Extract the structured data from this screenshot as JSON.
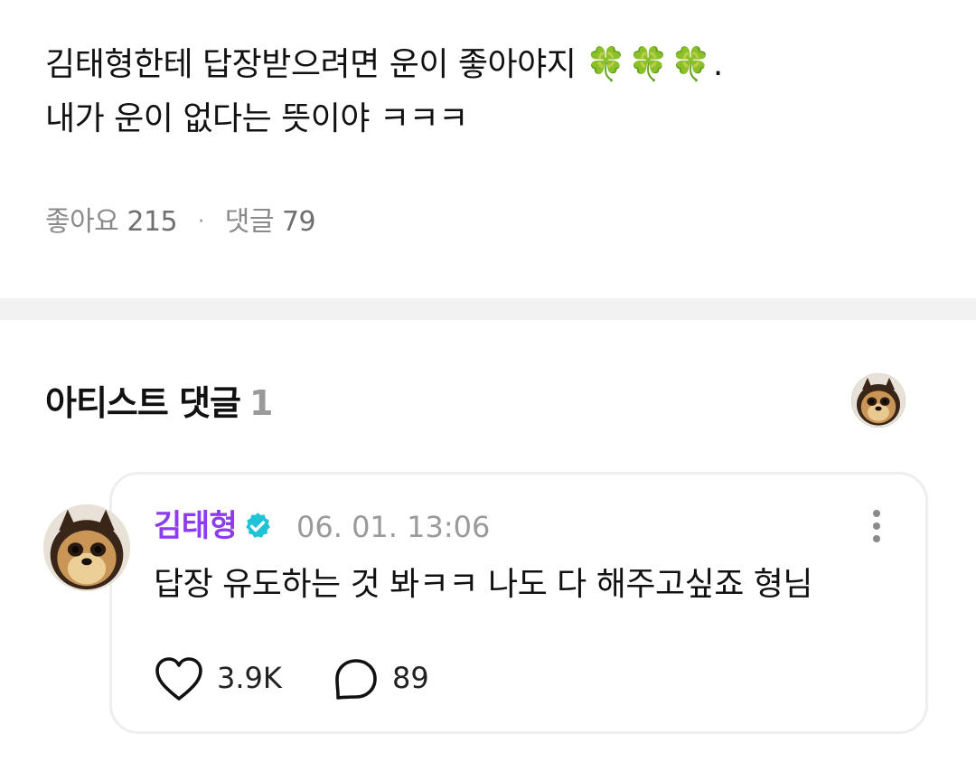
{
  "post": {
    "line1": "김태형한테 답장받으려면 운이 좋아야지",
    "clovers": "🍀🍀🍀",
    "line1_end": ".",
    "line2": "내가 운이 없다는 뜻이야 ㅋㅋㅋ"
  },
  "meta": {
    "likes_label": "좋아요",
    "likes_count": "215",
    "separator": "·",
    "comments_label": "댓글",
    "comments_count": "79"
  },
  "artist_comments": {
    "title": "아티스트 댓글",
    "count": "1"
  },
  "comment": {
    "author": "김태형",
    "date": "06. 01. 13:06",
    "text": "답장 유도하는 것 봐ㅋㅋ 나도 다 해주고싶죠 형님",
    "like_count": "3.9K",
    "reply_count": "89",
    "accent_color": "#8e3cf0",
    "verified_color": "#1fc3d6"
  }
}
